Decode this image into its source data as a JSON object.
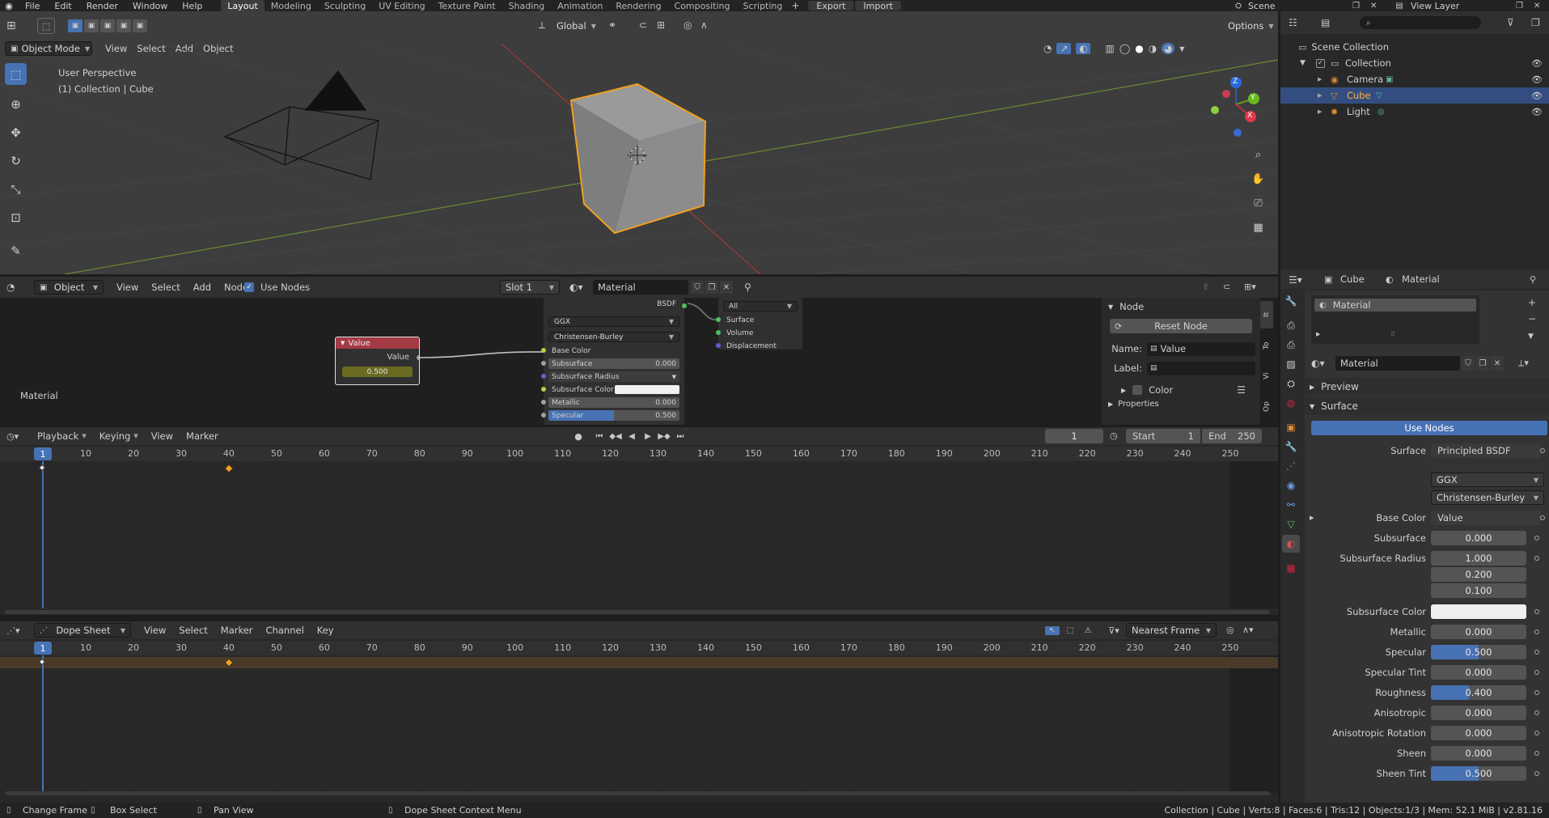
{
  "topbar": {
    "menus": [
      "File",
      "Edit",
      "Render",
      "Window",
      "Help"
    ],
    "workspaces": [
      "Layout",
      "Modeling",
      "Sculpting",
      "UV Editing",
      "Texture Paint",
      "Shading",
      "Animation",
      "Rendering",
      "Compositing",
      "Scripting"
    ],
    "active_workspace": "Layout",
    "export_label": "Export",
    "import_label": "Import",
    "scene": "Scene",
    "view_layer": "View Layer"
  },
  "viewport": {
    "mode": "Object Mode",
    "menus": [
      "View",
      "Select",
      "Add",
      "Object"
    ],
    "orientation": "Global",
    "options": "Options",
    "overlay_line1": "User Perspective",
    "overlay_line2": "(1) Collection | Cube",
    "gizmo": {
      "x": "X",
      "y": "Y",
      "z": "Z"
    }
  },
  "outliner": {
    "root": "Scene Collection",
    "collection": "Collection",
    "items": [
      {
        "label": "Camera",
        "selected": false
      },
      {
        "label": "Cube",
        "selected": true
      },
      {
        "label": "Light",
        "selected": false
      }
    ]
  },
  "node_editor": {
    "type": "Object",
    "menus": [
      "View",
      "Select",
      "Add",
      "Node"
    ],
    "use_nodes": "Use Nodes",
    "slot": "Slot 1",
    "material": "Material",
    "label": "Material",
    "value_node": {
      "title": "Value",
      "output": "Value",
      "value": "0.500"
    },
    "bsdf": {
      "output": "BSDF",
      "distribution": "GGX",
      "subsurface_method": "Christensen-Burley",
      "inputs": [
        {
          "label": "Base Color",
          "value": ""
        },
        {
          "label": "Subsurface",
          "value": "0.000"
        },
        {
          "label": "Subsurface Radius",
          "value": ""
        },
        {
          "label": "Subsurface Color",
          "value": ""
        },
        {
          "label": "Metallic",
          "value": "0.000"
        },
        {
          "label": "Specular",
          "value": "0.500"
        }
      ]
    },
    "output_node": {
      "target": "All",
      "inputs": [
        "Surface",
        "Volume",
        "Displacement"
      ]
    },
    "side": {
      "panel": "Node",
      "reset": "Reset Node",
      "name_label": "Name:",
      "name_value": "Value",
      "label_label": "Label:",
      "color": "Color",
      "properties": "Properties",
      "tabs": [
        "Item",
        "Tool",
        "View",
        "Options"
      ]
    }
  },
  "timeline": {
    "menus": [
      "Playback",
      "Keying",
      "View",
      "Marker"
    ],
    "current_frame": "1",
    "start_label": "Start",
    "start": "1",
    "end_label": "End",
    "end": "250",
    "ticks": [
      "10",
      "20",
      "30",
      "40",
      "50",
      "60",
      "70",
      "80",
      "90",
      "100",
      "110",
      "120",
      "130",
      "140",
      "150",
      "160",
      "170",
      "180",
      "190",
      "200",
      "210",
      "220",
      "230",
      "240",
      "250"
    ],
    "playhead": "1",
    "keyframes": [
      1,
      40
    ]
  },
  "dopesheet": {
    "mode": "Dope Sheet",
    "menus": [
      "View",
      "Select",
      "Marker",
      "Channel",
      "Key"
    ],
    "snap": "Nearest Frame",
    "playhead": "1"
  },
  "properties": {
    "object": "Cube",
    "material": "Material",
    "slot_name": "Material",
    "material_field": "Material",
    "preview": "Preview",
    "surface_panel": "Surface",
    "use_nodes": "Use Nodes",
    "surface_label": "Surface",
    "surface_value": "Principled BSDF",
    "distribution": "GGX",
    "subsurface_method": "Christensen-Burley",
    "base_color_label": "Base Color",
    "base_color_value": "Value",
    "rows": [
      {
        "label": "Subsurface",
        "value": "0.000",
        "fill": 0
      },
      {
        "label": "Subsurface Radius",
        "value": "1.000",
        "fill": 0
      },
      {
        "label": "",
        "value": "0.200",
        "fill": 0
      },
      {
        "label": "",
        "value": "0.100",
        "fill": 0
      },
      {
        "label": "Subsurface Color",
        "value": "",
        "fill": 0
      },
      {
        "label": "Metallic",
        "value": "0.000",
        "fill": 0
      },
      {
        "label": "Specular",
        "value": "0.500",
        "fill": 0.5
      },
      {
        "label": "Specular Tint",
        "value": "0.000",
        "fill": 0
      },
      {
        "label": "Roughness",
        "value": "0.400",
        "fill": 0.4
      },
      {
        "label": "Anisotropic",
        "value": "0.000",
        "fill": 0
      },
      {
        "label": "Anisotropic Rotation",
        "value": "0.000",
        "fill": 0
      },
      {
        "label": "Sheen",
        "value": "0.000",
        "fill": 0
      },
      {
        "label": "Sheen Tint",
        "value": "0.500",
        "fill": 0.5
      }
    ]
  },
  "statusbar": {
    "change_frame": "Change Frame",
    "box_select": "Box Select",
    "pan_view": "Pan View",
    "context_menu": "Dope Sheet Context Menu",
    "stats": "Collection | Cube | Verts:8 | Faces:6 | Tris:12 | Objects:1/3 | Mem: 52.1 MiB | v2.81.16"
  },
  "colors": {
    "accent": "#4772b3",
    "selected_orange": "#f0a020",
    "header": "#303030",
    "playhead": "#4772b3"
  }
}
